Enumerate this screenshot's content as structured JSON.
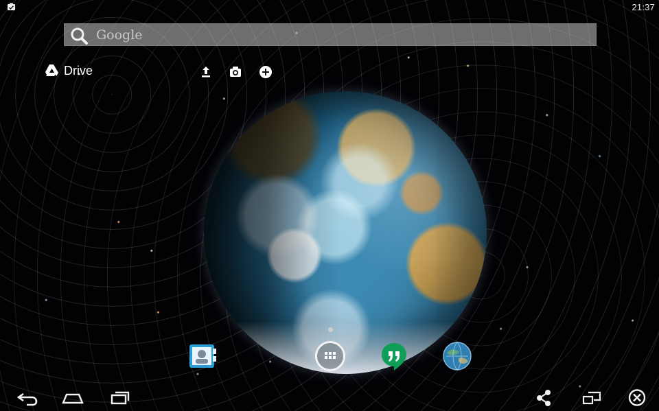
{
  "status_bar": {
    "time": "21:37",
    "notification_icon": "clipboard-check-icon"
  },
  "search": {
    "placeholder": "Google",
    "icon": "search-icon"
  },
  "drive_widget": {
    "label": "Drive",
    "icon": "google-drive-icon",
    "actions": [
      {
        "icon": "upload-icon"
      },
      {
        "icon": "camera-icon"
      },
      {
        "icon": "add-icon"
      }
    ]
  },
  "dock": {
    "apps": [
      {
        "icon": "contacts-icon"
      },
      {
        "icon": "all-apps-icon"
      },
      {
        "icon": "hangouts-icon"
      },
      {
        "icon": "earth-icon"
      }
    ]
  },
  "navigation": {
    "left": [
      "back-icon",
      "home-icon",
      "recent-apps-icon"
    ],
    "right": [
      "share-icon",
      "window-mode-icon",
      "close-icon"
    ]
  },
  "colors": {
    "background": "#020205",
    "search_bar": "#8f8f8f",
    "hangouts_green": "#0f9d58",
    "contacts_blue": "#2b9cd5",
    "earth_blue": "#2f7fb0"
  }
}
